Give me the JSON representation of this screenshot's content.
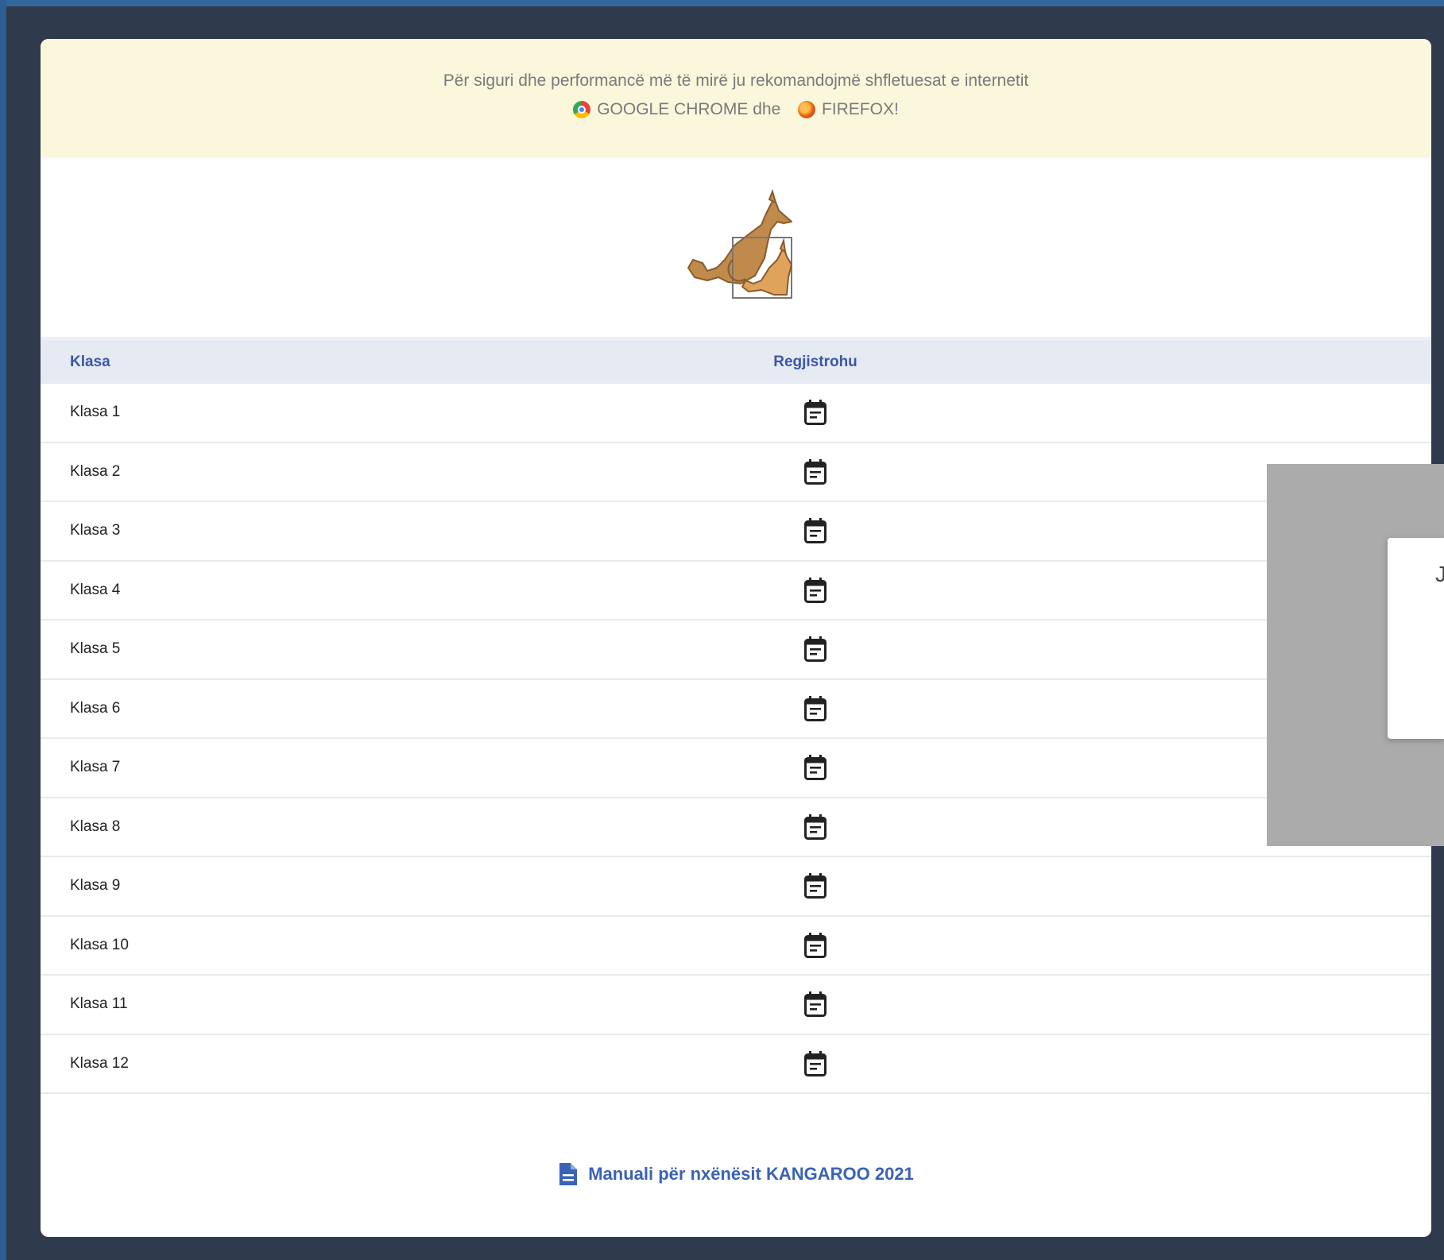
{
  "banner": {
    "line1": "Për siguri dhe performancë më të mirë ju rekomandojmë shfletuesat e internetit",
    "chrome": "GOOGLE CHROME dhe",
    "firefox": "FIREFOX!"
  },
  "logo": {
    "name": "kangaroo-logo"
  },
  "table": {
    "headers": {
      "class": "Klasa",
      "register": "Regjistrohu"
    },
    "rows": [
      {
        "label": "Klasa 1"
      },
      {
        "label": "Klasa 2"
      },
      {
        "label": "Klasa 3"
      },
      {
        "label": "Klasa 4"
      },
      {
        "label": "Klasa 5"
      },
      {
        "label": "Klasa 6"
      },
      {
        "label": "Klasa 7"
      },
      {
        "label": "Klasa 8"
      },
      {
        "label": "Klasa 9"
      },
      {
        "label": "Klasa 10"
      },
      {
        "label": "Klasa 11"
      },
      {
        "label": "Klasa 12"
      }
    ]
  },
  "footer": {
    "manual_link": "Manuali për nxënësit KANGAROO 2021"
  },
  "dialog": {
    "glyph": "J"
  },
  "colors": {
    "page_bg": "#2f3a4c",
    "banner_bg": "#fbf7dd",
    "header_bg": "#e6eaf2",
    "accent": "#3a62b6"
  }
}
